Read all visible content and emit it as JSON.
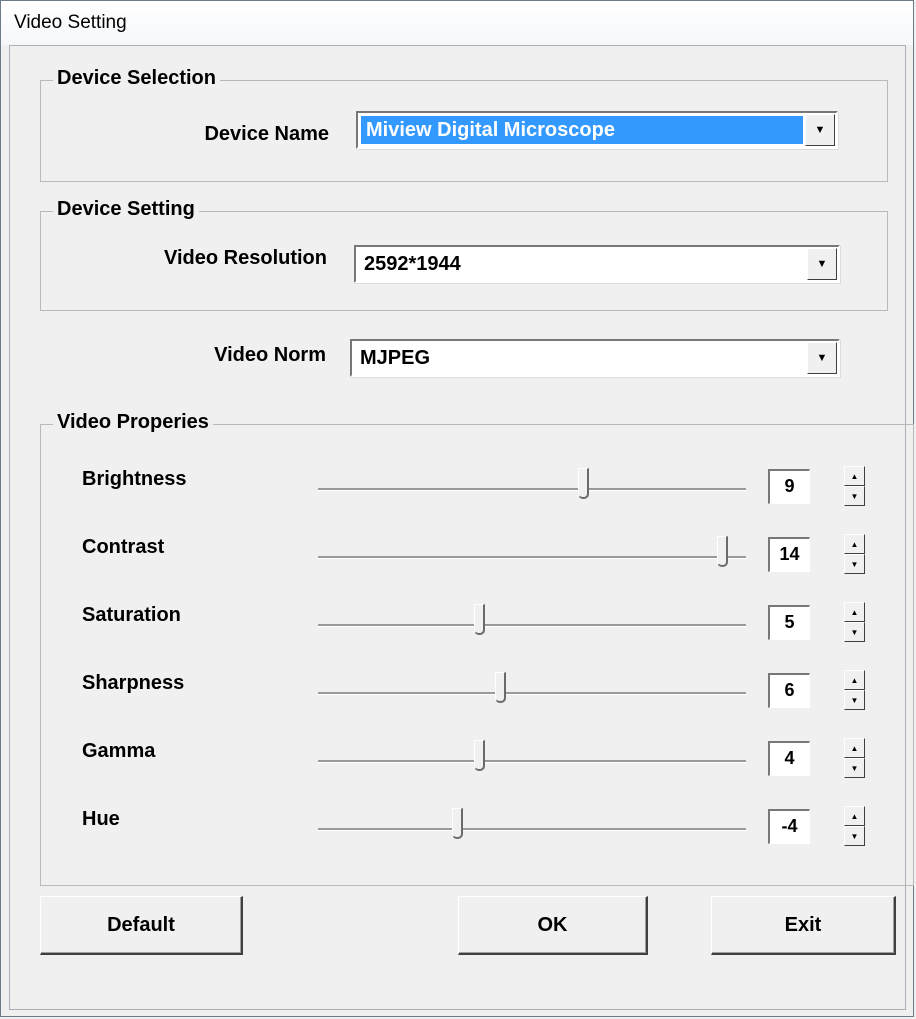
{
  "window": {
    "title": "Video Setting"
  },
  "device_selection": {
    "group_label": "Device Selection",
    "device_name_label": "Device Name",
    "device_name_value": "Miview Digital Microscope"
  },
  "device_setting": {
    "group_label": "Device Setting",
    "video_resolution_label": "Video Resolution",
    "video_resolution_value": "2592*1944"
  },
  "video_norm": {
    "label": "Video Norm",
    "value": "MJPEG"
  },
  "video_properties": {
    "group_label": "Video Properies",
    "sliders": [
      {
        "label": "Brightness",
        "value": "9",
        "position_fraction": 0.62
      },
      {
        "label": "Contrast",
        "value": "14",
        "position_fraction": 0.945
      },
      {
        "label": "Saturation",
        "value": "5",
        "position_fraction": 0.375
      },
      {
        "label": "Sharpness",
        "value": "6",
        "position_fraction": 0.425
      },
      {
        "label": "Gamma",
        "value": "4",
        "position_fraction": 0.375
      },
      {
        "label": "Hue",
        "value": "-4",
        "position_fraction": 0.325
      }
    ]
  },
  "buttons": {
    "default_label": "Default",
    "ok_label": "OK",
    "exit_label": "Exit"
  },
  "icons": {
    "dropdown": "chevron-down-icon",
    "spin_up": "spin-up-icon",
    "spin_down": "spin-down-icon"
  },
  "colors": {
    "highlight": "#3399ff",
    "dialog_background": "#f0f0f0"
  }
}
